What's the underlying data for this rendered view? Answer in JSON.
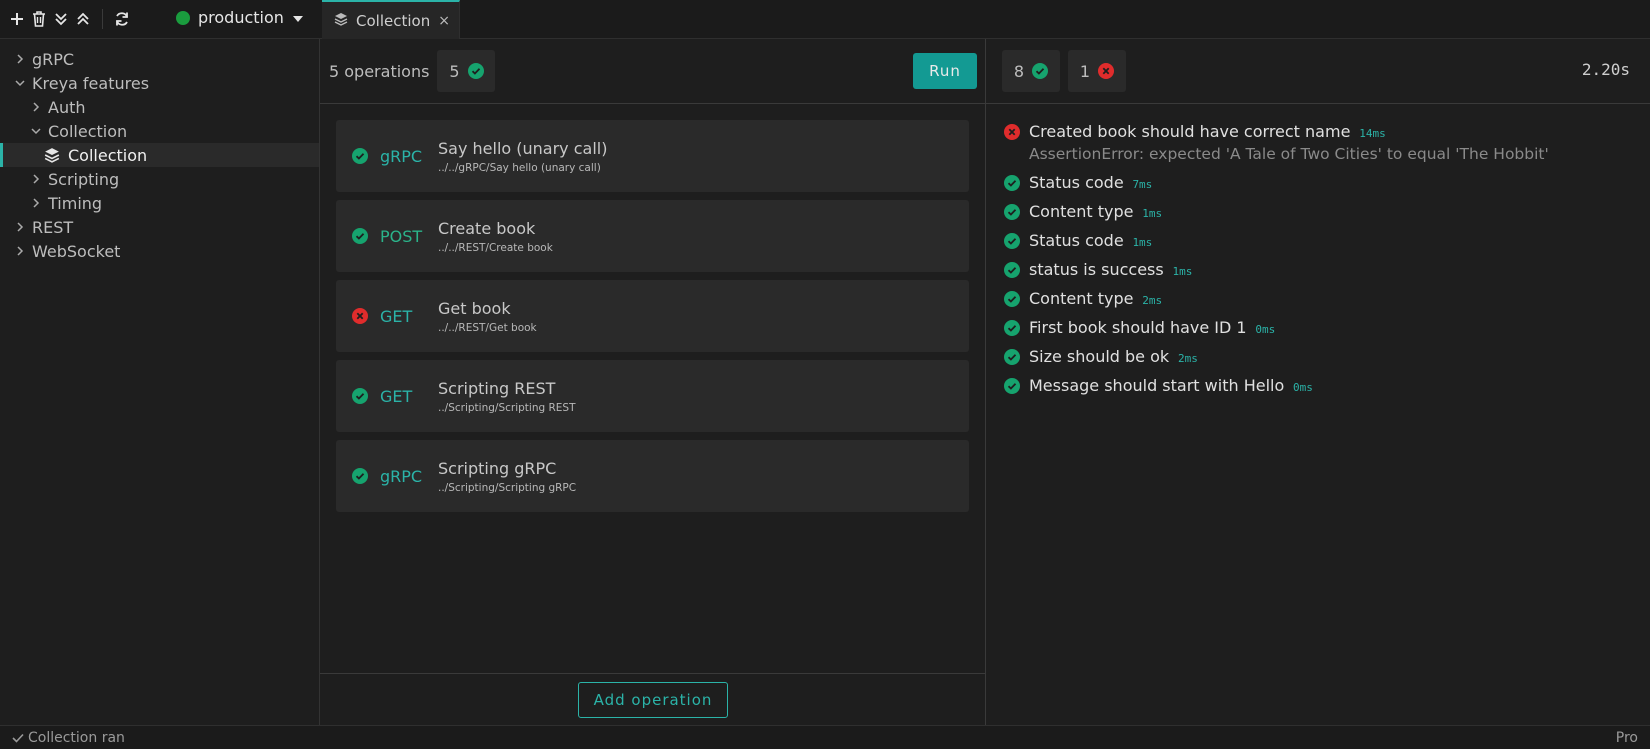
{
  "colors": {
    "accent": "#2bb3a8",
    "success": "#16a36e",
    "error": "#e02c2c",
    "env_dot": "#1a9c3e"
  },
  "toolbar": {
    "icons": [
      "plus-icon",
      "trash-icon",
      "collapse-all-icon",
      "expand-all-icon",
      "refresh-icon"
    ]
  },
  "environment": {
    "name": "production"
  },
  "tab": {
    "label": "Collection",
    "close": "×"
  },
  "sidebar": {
    "items": [
      {
        "label": "gRPC",
        "expanded": false
      },
      {
        "label": "Kreya features",
        "expanded": true
      },
      {
        "label": "Auth",
        "expanded": false
      },
      {
        "label": "Collection",
        "expanded": true
      },
      {
        "label": "Collection",
        "selected": true
      },
      {
        "label": "Scripting",
        "expanded": false
      },
      {
        "label": "Timing",
        "expanded": false
      },
      {
        "label": "REST",
        "expanded": false
      },
      {
        "label": "WebSocket",
        "expanded": false
      }
    ]
  },
  "operations": {
    "count_label": "5 operations",
    "success_count": "5",
    "run_label": "Run",
    "add_label": "Add operation",
    "items": [
      {
        "status": "success",
        "method": "gRPC",
        "name": "Say hello (unary call)",
        "path": "../../gRPC/Say hello (unary call)"
      },
      {
        "status": "success",
        "method": "POST",
        "name": "Create book",
        "path": "../../REST/Create book"
      },
      {
        "status": "error",
        "method": "GET",
        "name": "Get book",
        "path": "../../REST/Get book"
      },
      {
        "status": "success",
        "method": "GET",
        "name": "Scripting REST",
        "path": "../Scripting/Scripting REST"
      },
      {
        "status": "success",
        "method": "gRPC",
        "name": "Scripting gRPC",
        "path": "../Scripting/Scripting gRPC"
      }
    ]
  },
  "results": {
    "passed": "8",
    "failed": "1",
    "duration": "2.20s",
    "items": [
      {
        "status": "error",
        "title": "Created book should have correct name",
        "time": "14ms",
        "error": "AssertionError: expected 'A Tale of Two Cities' to equal 'The Hobbit'"
      },
      {
        "status": "success",
        "title": "Status code",
        "time": "7ms"
      },
      {
        "status": "success",
        "title": "Content type",
        "time": "1ms"
      },
      {
        "status": "success",
        "title": "Status code",
        "time": "1ms"
      },
      {
        "status": "success",
        "title": "status is success",
        "time": "1ms"
      },
      {
        "status": "success",
        "title": "Content type",
        "time": "2ms"
      },
      {
        "status": "success",
        "title": "First book should have ID 1",
        "time": "0ms"
      },
      {
        "status": "success",
        "title": "Size should be ok",
        "time": "2ms"
      },
      {
        "status": "success",
        "title": "Message should start with Hello",
        "time": "0ms"
      }
    ]
  },
  "statusbar": {
    "message": "Collection ran",
    "edition": "Pro"
  }
}
